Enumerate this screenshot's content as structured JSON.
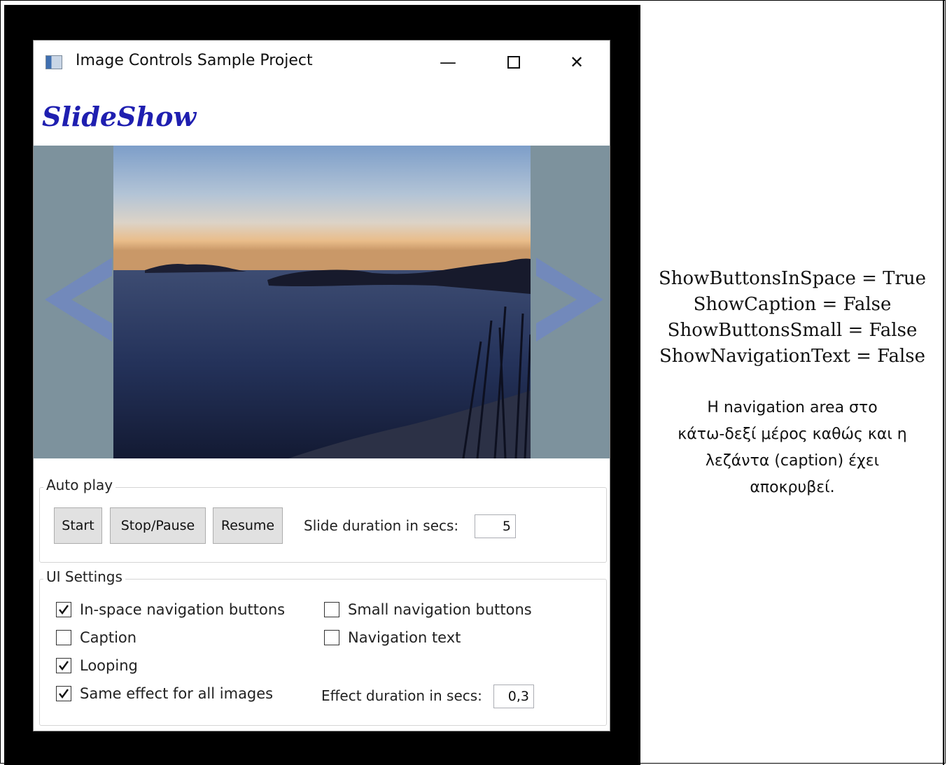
{
  "window": {
    "title": "Image Controls Sample Project",
    "minimize_glyph": "—",
    "close_glyph": "✕",
    "heading": "SlideShow"
  },
  "slideshow": {
    "nav_arrow_color": "#6f86c6",
    "background_color": "#7d929d"
  },
  "autoplay": {
    "group_label": "Auto play",
    "start_label": "Start",
    "stop_label": "Stop/Pause",
    "resume_label": "Resume",
    "slide_duration_label": "Slide duration in secs:",
    "slide_duration_value": "5"
  },
  "ui_settings": {
    "group_label": "UI Settings",
    "checkboxes": [
      {
        "label": "In-space navigation buttons",
        "checked": true
      },
      {
        "label": "Small navigation buttons",
        "checked": false
      },
      {
        "label": "Caption",
        "checked": false
      },
      {
        "label": "Navigation text",
        "checked": false
      },
      {
        "label": "Looping",
        "checked": true
      },
      {
        "label": "Same effect for all images",
        "checked": true
      }
    ],
    "effect_duration_label": "Effect duration in secs:",
    "effect_duration_value": "0,3"
  },
  "info": {
    "properties": [
      "ShowButtonsInSpace = True",
      "ShowCaption = False",
      "ShowButtonsSmall = False",
      "ShowNavigationText = False"
    ],
    "note_lines": [
      "Η navigation area στο",
      "κάτω-δεξί μέρος καθώς και η",
      "λεζάντα (caption) έχει",
      "αποκρυβεί."
    ]
  }
}
